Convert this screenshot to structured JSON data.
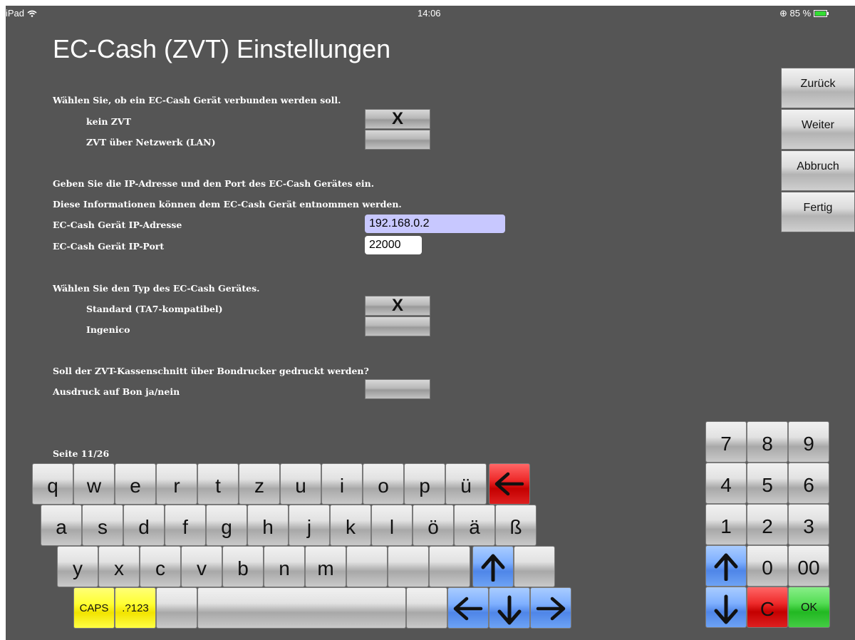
{
  "status": {
    "device": "iPad",
    "time": "14:06",
    "battery": "85 %"
  },
  "title": "EC-Cash (ZVT) Einstellungen",
  "section1": {
    "heading": "Wählen Sie, ob ein EC-Cash Gerät verbunden werden soll.",
    "options": [
      {
        "label": "kein ZVT",
        "mark": "X"
      },
      {
        "label": "ZVT über Netzwerk (LAN)",
        "mark": ""
      }
    ]
  },
  "section2": {
    "line1": "Geben Sie die IP-Adresse und den Port des EC-Cash Gerätes ein.",
    "line2": "Diese Informationen können dem EC-Cash Gerät entnommen werden.",
    "ip_label": "EC-Cash Gerät IP-Adresse",
    "ip_value": "192.168.0.2",
    "port_label": "EC-Cash Gerät IP-Port",
    "port_value": "22000"
  },
  "section3": {
    "heading": "Wählen Sie den Typ des EC-Cash Gerätes.",
    "options": [
      {
        "label": "Standard (TA7-kompatibel)",
        "mark": "X"
      },
      {
        "label": "Ingenico",
        "mark": ""
      }
    ]
  },
  "section4": {
    "heading": "Soll der ZVT-Kassenschnitt über Bondrucker gedruckt werden?",
    "label": "Ausdruck auf Bon ja/nein",
    "mark": ""
  },
  "page_indicator": "Seite 11/26",
  "nav": {
    "back": "Zurück",
    "next": "Weiter",
    "cancel": "Abbruch",
    "done": "Fertig"
  },
  "keyboard": {
    "row1": [
      "q",
      "w",
      "e",
      "r",
      "t",
      "z",
      "u",
      "i",
      "o",
      "p",
      "ü"
    ],
    "row2": [
      "a",
      "s",
      "d",
      "f",
      "g",
      "h",
      "j",
      "k",
      "l",
      "ö",
      "ä",
      "ß"
    ],
    "row3": [
      "y",
      "x",
      "c",
      "v",
      "b",
      "n",
      "m"
    ],
    "caps": "CAPS",
    "symbols": ".?123"
  },
  "numpad": {
    "row1": [
      "7",
      "8",
      "9"
    ],
    "row2": [
      "4",
      "5",
      "6"
    ],
    "row3": [
      "1",
      "2",
      "3"
    ],
    "zero": "0",
    "double_zero": "00",
    "clear": "C",
    "ok": "OK"
  },
  "colors": {
    "background": "#555555",
    "ip_field": "#c8c8ff",
    "port_field": "#ffffff",
    "backspace_key": "#dd2020",
    "arrow_keys": "#6da2f4",
    "caps_keys": "#ffff44",
    "ok_key": "#44cc44",
    "clear_key": "#dd2020"
  },
  "icons": {
    "backspace": "arrow-left-icon",
    "shift": "arrow-up-icon",
    "cursor_left": "arrow-left-icon",
    "cursor_down": "arrow-down-icon",
    "cursor_right": "arrow-right-icon"
  }
}
